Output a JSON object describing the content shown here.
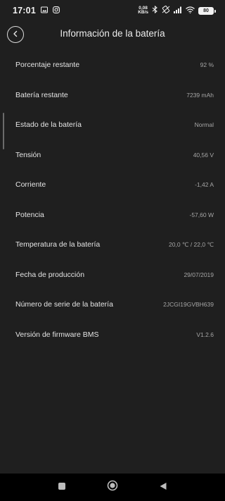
{
  "status_bar": {
    "time": "17:01",
    "net_speed_value": "0,08",
    "net_speed_unit": "KB/s",
    "battery_level": "80",
    "icons": [
      "gallery-icon",
      "instagram-icon",
      "bluetooth-icon",
      "rotation-icon",
      "signal-icon",
      "wifi-icon",
      "battery-icon"
    ]
  },
  "header": {
    "title": "Información de la batería",
    "back_icon": "chevron-left-icon"
  },
  "rows": [
    {
      "label": "Porcentaje restante",
      "value": "92 %"
    },
    {
      "label": "Batería restante",
      "value": "7239 mAh"
    },
    {
      "label": "Estado de la batería",
      "value": "Normal"
    },
    {
      "label": "Tensión",
      "value": "40,56 V"
    },
    {
      "label": "Corriente",
      "value": "-1,42 A"
    },
    {
      "label": "Potencia",
      "value": "-57,60 W"
    },
    {
      "label": "Temperatura de la batería",
      "value": "20,0 ℃ / 22,0 ℃"
    },
    {
      "label": "Fecha de producción",
      "value": "29/07/2019"
    },
    {
      "label": "Número de serie de la batería",
      "value": "2JCGI19GVBH639"
    },
    {
      "label": "Versión de firmware BMS",
      "value": "V1.2.6"
    }
  ],
  "nav_bar": {
    "icons": [
      "recents-icon",
      "home-icon",
      "back-icon"
    ]
  },
  "colors": {
    "background": "#1f1f1f",
    "nav_background": "#000000",
    "label_text": "#e4e4e4",
    "value_text": "#a6a6a6"
  }
}
